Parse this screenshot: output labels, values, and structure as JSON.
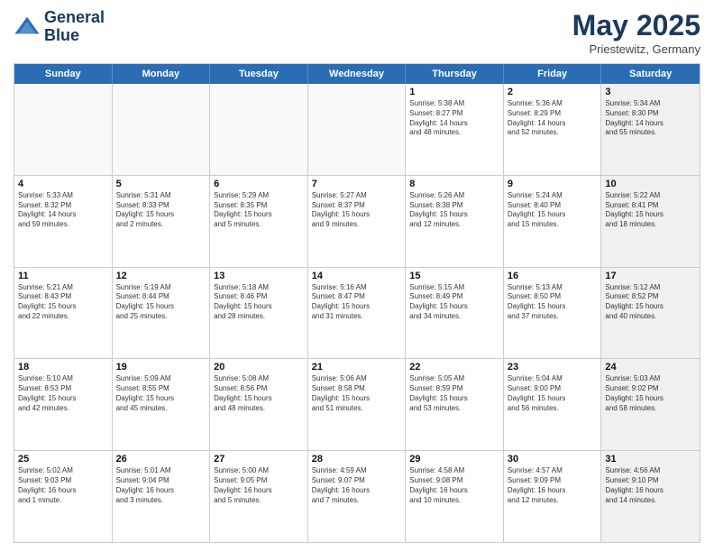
{
  "logo": {
    "line1": "General",
    "line2": "Blue"
  },
  "title": "May 2025",
  "location": "Priestewitz, Germany",
  "header_days": [
    "Sunday",
    "Monday",
    "Tuesday",
    "Wednesday",
    "Thursday",
    "Friday",
    "Saturday"
  ],
  "rows": [
    [
      {
        "day": "",
        "text": "",
        "empty": true
      },
      {
        "day": "",
        "text": "",
        "empty": true
      },
      {
        "day": "",
        "text": "",
        "empty": true
      },
      {
        "day": "",
        "text": "",
        "empty": true
      },
      {
        "day": "1",
        "text": "Sunrise: 5:38 AM\nSunset: 8:27 PM\nDaylight: 14 hours\nand 48 minutes."
      },
      {
        "day": "2",
        "text": "Sunrise: 5:36 AM\nSunset: 8:29 PM\nDaylight: 14 hours\nand 52 minutes."
      },
      {
        "day": "3",
        "text": "Sunrise: 5:34 AM\nSunset: 8:30 PM\nDaylight: 14 hours\nand 55 minutes.",
        "shaded": true
      }
    ],
    [
      {
        "day": "4",
        "text": "Sunrise: 5:33 AM\nSunset: 8:32 PM\nDaylight: 14 hours\nand 59 minutes."
      },
      {
        "day": "5",
        "text": "Sunrise: 5:31 AM\nSunset: 8:33 PM\nDaylight: 15 hours\nand 2 minutes."
      },
      {
        "day": "6",
        "text": "Sunrise: 5:29 AM\nSunset: 8:35 PM\nDaylight: 15 hours\nand 5 minutes."
      },
      {
        "day": "7",
        "text": "Sunrise: 5:27 AM\nSunset: 8:37 PM\nDaylight: 15 hours\nand 9 minutes."
      },
      {
        "day": "8",
        "text": "Sunrise: 5:26 AM\nSunset: 8:38 PM\nDaylight: 15 hours\nand 12 minutes."
      },
      {
        "day": "9",
        "text": "Sunrise: 5:24 AM\nSunset: 8:40 PM\nDaylight: 15 hours\nand 15 minutes."
      },
      {
        "day": "10",
        "text": "Sunrise: 5:22 AM\nSunset: 8:41 PM\nDaylight: 15 hours\nand 18 minutes.",
        "shaded": true
      }
    ],
    [
      {
        "day": "11",
        "text": "Sunrise: 5:21 AM\nSunset: 8:43 PM\nDaylight: 15 hours\nand 22 minutes."
      },
      {
        "day": "12",
        "text": "Sunrise: 5:19 AM\nSunset: 8:44 PM\nDaylight: 15 hours\nand 25 minutes."
      },
      {
        "day": "13",
        "text": "Sunrise: 5:18 AM\nSunset: 8:46 PM\nDaylight: 15 hours\nand 28 minutes."
      },
      {
        "day": "14",
        "text": "Sunrise: 5:16 AM\nSunset: 8:47 PM\nDaylight: 15 hours\nand 31 minutes."
      },
      {
        "day": "15",
        "text": "Sunrise: 5:15 AM\nSunset: 8:49 PM\nDaylight: 15 hours\nand 34 minutes."
      },
      {
        "day": "16",
        "text": "Sunrise: 5:13 AM\nSunset: 8:50 PM\nDaylight: 15 hours\nand 37 minutes."
      },
      {
        "day": "17",
        "text": "Sunrise: 5:12 AM\nSunset: 8:52 PM\nDaylight: 15 hours\nand 40 minutes.",
        "shaded": true
      }
    ],
    [
      {
        "day": "18",
        "text": "Sunrise: 5:10 AM\nSunset: 8:53 PM\nDaylight: 15 hours\nand 42 minutes."
      },
      {
        "day": "19",
        "text": "Sunrise: 5:09 AM\nSunset: 8:55 PM\nDaylight: 15 hours\nand 45 minutes."
      },
      {
        "day": "20",
        "text": "Sunrise: 5:08 AM\nSunset: 8:56 PM\nDaylight: 15 hours\nand 48 minutes."
      },
      {
        "day": "21",
        "text": "Sunrise: 5:06 AM\nSunset: 8:58 PM\nDaylight: 15 hours\nand 51 minutes."
      },
      {
        "day": "22",
        "text": "Sunrise: 5:05 AM\nSunset: 8:59 PM\nDaylight: 15 hours\nand 53 minutes."
      },
      {
        "day": "23",
        "text": "Sunrise: 5:04 AM\nSunset: 9:00 PM\nDaylight: 15 hours\nand 56 minutes."
      },
      {
        "day": "24",
        "text": "Sunrise: 5:03 AM\nSunset: 9:02 PM\nDaylight: 15 hours\nand 58 minutes.",
        "shaded": true
      }
    ],
    [
      {
        "day": "25",
        "text": "Sunrise: 5:02 AM\nSunset: 9:03 PM\nDaylight: 16 hours\nand 1 minute."
      },
      {
        "day": "26",
        "text": "Sunrise: 5:01 AM\nSunset: 9:04 PM\nDaylight: 16 hours\nand 3 minutes."
      },
      {
        "day": "27",
        "text": "Sunrise: 5:00 AM\nSunset: 9:05 PM\nDaylight: 16 hours\nand 5 minutes."
      },
      {
        "day": "28",
        "text": "Sunrise: 4:59 AM\nSunset: 9:07 PM\nDaylight: 16 hours\nand 7 minutes."
      },
      {
        "day": "29",
        "text": "Sunrise: 4:58 AM\nSunset: 9:08 PM\nDaylight: 16 hours\nand 10 minutes."
      },
      {
        "day": "30",
        "text": "Sunrise: 4:57 AM\nSunset: 9:09 PM\nDaylight: 16 hours\nand 12 minutes."
      },
      {
        "day": "31",
        "text": "Sunrise: 4:56 AM\nSunset: 9:10 PM\nDaylight: 16 hours\nand 14 minutes.",
        "shaded": true
      }
    ]
  ]
}
